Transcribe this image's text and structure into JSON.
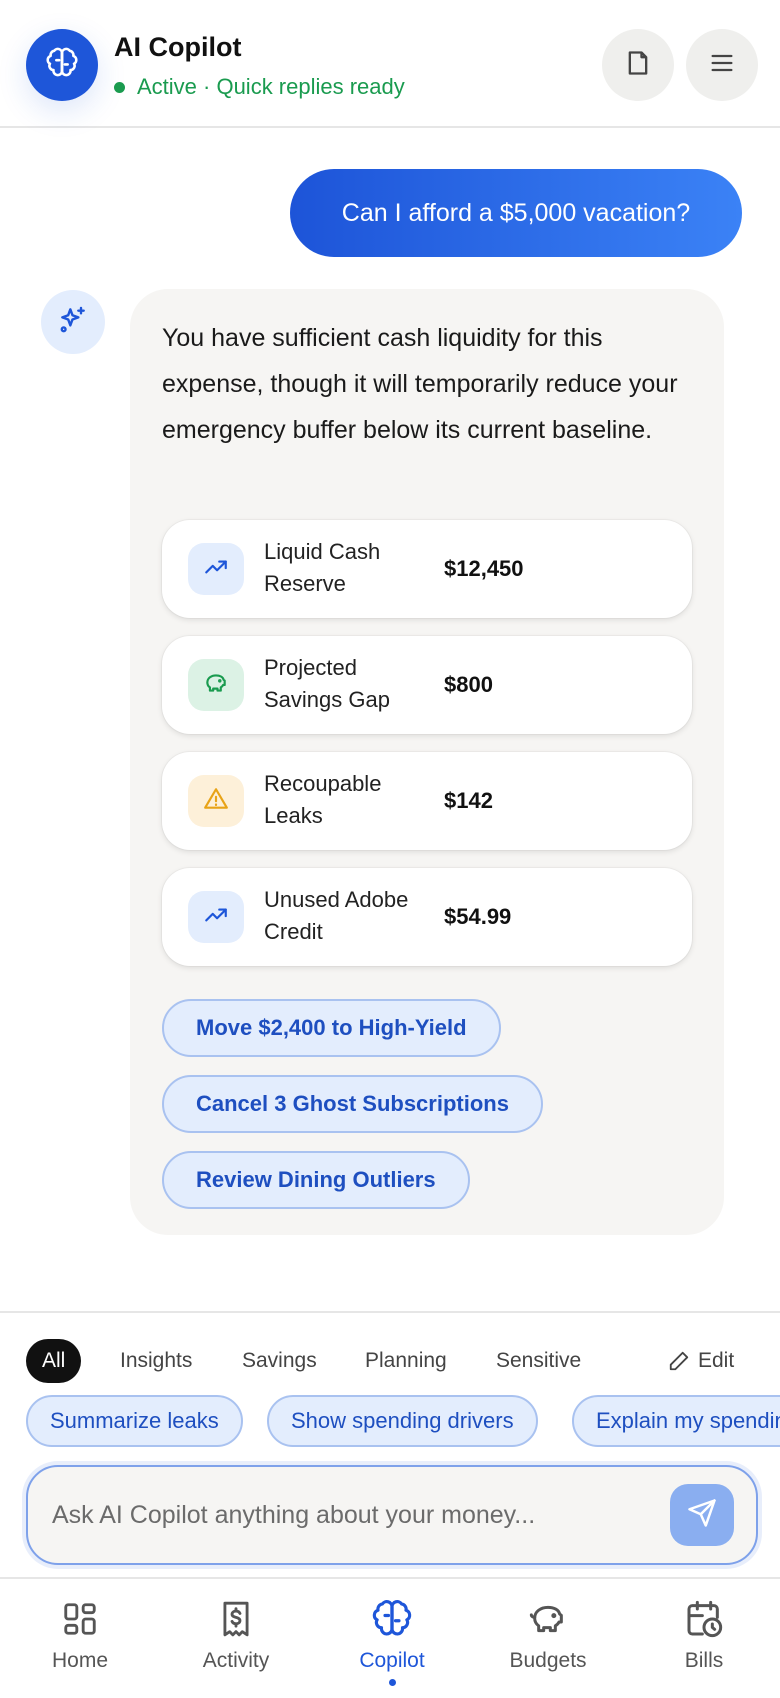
{
  "header": {
    "title": "AI Copilot",
    "status": "Active · Quick replies ready",
    "logo_icon": "brain-icon",
    "notes_icon": "note-icon",
    "menu_icon": "menu-icon"
  },
  "conversation": {
    "user_message": "Can I afford a $5,000 vacation?",
    "ai_icon": "sparkles-icon",
    "ai_message": "You have sufficient cash liquidity for this expense, though it will temporarily reduce your emergency buffer below its current baseline.",
    "stats": [
      {
        "label": "Liquid Cash Reserve",
        "value": "$12,450",
        "icon": "trend-up-icon",
        "color": "#1e56d9"
      },
      {
        "label": "Projected Savings Gap",
        "value": "$800",
        "icon": "piggy-bank-icon",
        "color": "#1a9b4f"
      },
      {
        "label": "Recoupable Leaks",
        "value": "$142",
        "icon": "warning-icon",
        "color": "#e8a317"
      },
      {
        "label": "Unused Adobe Credit",
        "value": "$54.99",
        "icon": "trend-up-icon",
        "color": "#1e56d9"
      }
    ],
    "actions": [
      "Move $2,400 to High-Yield",
      "Cancel 3 Ghost Subscriptions",
      "Review Dining Outliers"
    ]
  },
  "filters": {
    "tabs": [
      "All",
      "Insights",
      "Savings",
      "Planning",
      "Sensitive"
    ],
    "active": "All",
    "edit_label": "Edit"
  },
  "suggestions": [
    "Summarize leaks",
    "Show spending drivers",
    "Explain my spending"
  ],
  "composer": {
    "placeholder": "Ask AI Copilot anything about your money...",
    "send_icon": "send-icon"
  },
  "nav": {
    "items": [
      {
        "label": "Home",
        "icon": "home-grid-icon"
      },
      {
        "label": "Activity",
        "icon": "receipt-icon"
      },
      {
        "label": "Copilot",
        "icon": "brain-icon"
      },
      {
        "label": "Budgets",
        "icon": "piggy-bank-icon"
      },
      {
        "label": "Bills",
        "icon": "calendar-clock-icon"
      }
    ],
    "active": "Copilot"
  },
  "colors": {
    "accent": "#1e56d9",
    "success": "#1a9b4f",
    "warning": "#e8a317",
    "chip_bg": "#e3edfd"
  }
}
